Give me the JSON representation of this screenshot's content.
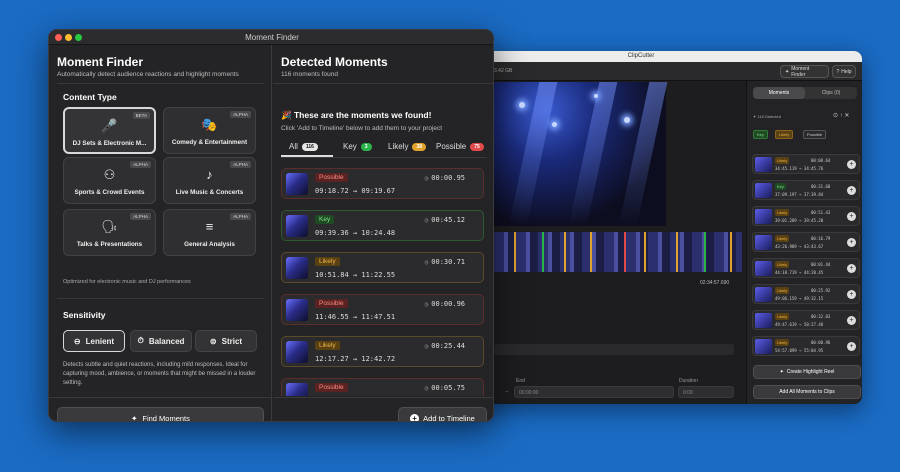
{
  "background_app": {
    "title": "ClipCutter",
    "size_text": "3.42 GB",
    "toolbar": {
      "moment_finder_label": "Moment Finder",
      "help_label": "Help"
    },
    "timecode": "02:34:57.690",
    "fields": {
      "end_label": "End",
      "end_value": "00:00:00",
      "duration_label": "Duration",
      "duration_value": "0:00"
    },
    "sidebar": {
      "tabs": [
        "Moments",
        "Clips (0)"
      ],
      "detected_text": "116 Detected",
      "filters": [
        "Key",
        "Likely",
        "Possible"
      ],
      "rows": [
        {
          "tag": "Likely",
          "start": "34:45.119",
          "end": "34:45.76",
          "duration": "00:08.64"
        },
        {
          "tag": "Key",
          "start": "37:09.197",
          "end": "37:39.84",
          "duration": "00:31.68"
        },
        {
          "tag": "Likely",
          "start": "39:01.289",
          "end": "39:45.20",
          "duration": "00:51.43"
        },
        {
          "tag": "Likely",
          "start": "43:26.989",
          "end": "43:43.67",
          "duration": "00:16.79"
        },
        {
          "tag": "Likely",
          "start": "44:18.719",
          "end": "44:20.45",
          "duration": "00:01.44"
        },
        {
          "tag": "Likely",
          "start": "49:06.159",
          "end": "49:32.15",
          "duration": "00:25.92"
        },
        {
          "tag": "Likely",
          "start": "49:47.619",
          "end": "50:27.48",
          "duration": "00:32.83"
        },
        {
          "tag": "Likely",
          "start": "54:57.899",
          "end": "55:04.95",
          "duration": "00:00.96"
        }
      ],
      "create_reel_label": "Create Highlight Reel",
      "add_all_label": "Add All Moments to Clips"
    }
  },
  "window": {
    "title": "Moment Finder"
  },
  "left": {
    "title": "Moment Finder",
    "subtitle": "Automatically detect audience reactions and highlight moments",
    "content_type_heading": "Content Type",
    "content_types": [
      {
        "label": "DJ Sets & Electronic M...",
        "badge": "BETA",
        "icon": "microphone-icon",
        "glyph": "🎤",
        "selected": true
      },
      {
        "label": "Comedy & Entertainment",
        "badge": "ALPHA",
        "icon": "theater-masks-icon",
        "glyph": "🎭",
        "selected": false
      },
      {
        "label": "Sports & Crowd Events",
        "badge": "ALPHA",
        "icon": "crowd-icon",
        "glyph": "⚇",
        "selected": false
      },
      {
        "label": "Live Music & Concerts",
        "badge": "ALPHA",
        "icon": "music-note-icon",
        "glyph": "♪",
        "selected": false
      },
      {
        "label": "Talks & Presentations",
        "badge": "ALPHA",
        "icon": "speaker-person-icon",
        "glyph": "🗣",
        "selected": false
      },
      {
        "label": "General Analysis",
        "badge": "ALPHA",
        "icon": "waveform-icon",
        "glyph": "≡",
        "selected": false
      }
    ],
    "content_note": "Optimized for electronic music and DJ performances",
    "sensitivity_heading": "Sensitivity",
    "sensitivity_options": [
      {
        "label": "Lenient",
        "glyph": "⊖",
        "selected": true
      },
      {
        "label": "Balanced",
        "glyph": "⏱",
        "selected": false
      },
      {
        "label": "Strict",
        "glyph": "⊜",
        "selected": false
      }
    ],
    "sensitivity_description": "Detects subtle and quiet reactions, including mild responses. Ideal for capturing mood, ambience, or moments that might be missed in a louder setting.",
    "find_button_label": "Find Moments"
  },
  "right": {
    "title": "Detected Moments",
    "count_text": "116 moments found",
    "announce_emoji": "🎉",
    "announce": "These are the moments we found!",
    "instruction": "Click 'Add to Timeline' below to add them to your project",
    "tabs": [
      {
        "label": "All",
        "count": "116",
        "color": "#e6e6e6",
        "text": "#111111"
      },
      {
        "label": "Key",
        "count": "3",
        "color": "#2bb44a",
        "text": "#ffffff"
      },
      {
        "label": "Likely",
        "count": "38",
        "color": "#e0a22a",
        "text": "#ffffff"
      },
      {
        "label": "Possible",
        "count": "75",
        "color": "#e04a4a",
        "text": "#ffffff"
      }
    ],
    "moments": [
      {
        "tag": "Possible",
        "kind": "possible",
        "start": "09:18.72",
        "end": "09:19.67",
        "duration": "00:00.95"
      },
      {
        "tag": "Key",
        "kind": "key",
        "start": "09:39.36",
        "end": "10:24.48",
        "duration": "00:45.12"
      },
      {
        "tag": "Likely",
        "kind": "likely",
        "start": "10:51.84",
        "end": "11:22.55",
        "duration": "00:30.71"
      },
      {
        "tag": "Possible",
        "kind": "possible",
        "start": "11:46.55",
        "end": "11:47.51",
        "duration": "00:00.96"
      },
      {
        "tag": "Likely",
        "kind": "likely",
        "start": "12:17.27",
        "end": "12:42.72",
        "duration": "00:25.44"
      },
      {
        "tag": "Possible",
        "kind": "possible",
        "start": "",
        "end": "",
        "duration": "00:05.75"
      }
    ],
    "add_button_label": "Add to Timeline"
  }
}
